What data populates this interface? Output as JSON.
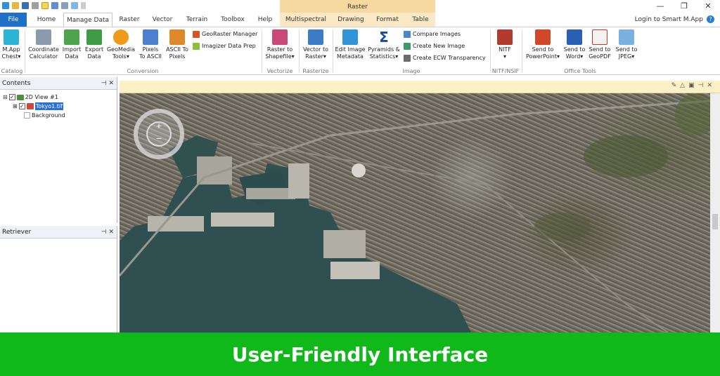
{
  "window": {
    "context_tab_group": "Raster",
    "controls": [
      "—",
      "❐",
      "✕"
    ],
    "login_text": "Login to Smart M.App",
    "help_icon": "?"
  },
  "tabs": [
    {
      "label": "File"
    },
    {
      "label": "Home"
    },
    {
      "label": "Manage Data",
      "active": true
    },
    {
      "label": "Raster"
    },
    {
      "label": "Vector"
    },
    {
      "label": "Terrain"
    },
    {
      "label": "Toolbox"
    },
    {
      "label": "Help"
    },
    {
      "label": "Multispectral"
    },
    {
      "label": "Drawing"
    },
    {
      "label": "Format"
    },
    {
      "label": "Table"
    }
  ],
  "ribbon": {
    "catalog": {
      "group": "Catalog",
      "mapp": "M.App\nChest▾"
    },
    "conversion": {
      "group": "Conversion",
      "coordinate": "Coordinate\nCalculator",
      "import": "Import\nData",
      "export": "Export\nData",
      "geomedia": "GeoMedia\nTools▾",
      "pixels_ascii": "Pixels\nTo ASCII",
      "ascii_pixels": "ASCII To\nPixels",
      "georaster": "GeoRaster Manager",
      "imagizer": "Imagizer Data Prep"
    },
    "vectorize": {
      "group": "Vectorize",
      "raster_shapefile": "Raster to\nShapefile▾"
    },
    "rasterize": {
      "group": "Rasterize",
      "vector_raster": "Vector to\nRaster▾"
    },
    "image": {
      "group": "Image",
      "edit_metadata": "Edit Image\nMetadata",
      "pyramids": "Pyramids &\nStatistics▾",
      "compare": "Compare Images",
      "create_new": "Create New Image",
      "ecw": "Create ECW Transparency"
    },
    "nitf": {
      "group": "NITF/NSIF",
      "nitf": "NITF\n▾"
    },
    "office": {
      "group": "Office Tools",
      "ppt": "Send to\nPowerPoint▾",
      "word": "Send to\nWord▾",
      "geopdf": "Send to\nGeoPDF",
      "jpeg": "Send to\nJPEG▾"
    }
  },
  "contents_pane": {
    "title": "Contents",
    "controls": "⊣ ✕",
    "tree": [
      {
        "label": "2D View #1",
        "checked": true
      },
      {
        "label": "Tokyo1.tif",
        "checked": true,
        "selected": true
      },
      {
        "label": "Background",
        "checked": false
      }
    ]
  },
  "retriever_pane": {
    "title": "Retriever",
    "controls": "⊣ ✕"
  },
  "map_view": {
    "toolbar_icons": [
      "pencil-icon",
      "warning-icon",
      "lock-icon",
      "pin-icon",
      "close-icon"
    ],
    "navigator": {
      "zoom_in": "+",
      "zoom_out": "−"
    }
  },
  "banner": {
    "text": "User-Friendly Interface",
    "color": "#11b81a"
  }
}
